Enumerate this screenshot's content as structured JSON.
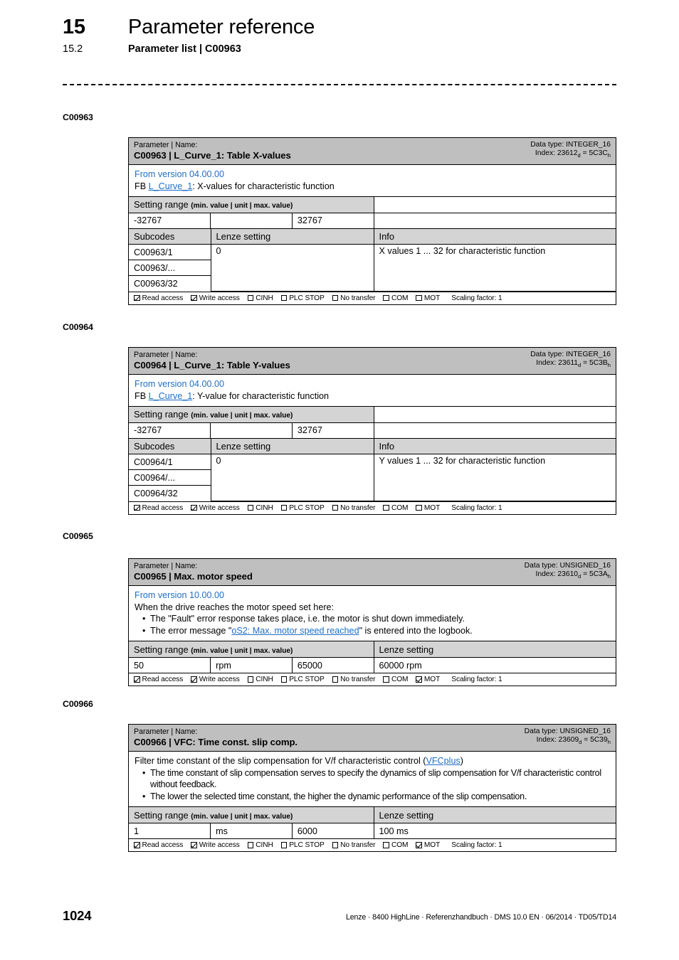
{
  "header": {
    "chapter_number": "15",
    "chapter_title": "Parameter reference",
    "section_number": "15.2",
    "section_title": "Parameter list | C00963"
  },
  "access_labels": {
    "read": "Read access",
    "write": "Write access",
    "cinh": "CINH",
    "plc_stop": "PLC STOP",
    "no_transfer": "No transfer",
    "com": "COM",
    "mot": "MOT"
  },
  "common": {
    "param_name_label": "Parameter | Name:",
    "setting_range_label": "Setting range",
    "setting_range_hint": "(min. value | unit | max. value)",
    "lenze_setting_label": "Lenze setting",
    "subcodes_label": "Subcodes",
    "info_label": "Info",
    "scaling_factor": "Scaling factor: 1"
  },
  "blocks": [
    {
      "margin_tag": "C00963",
      "title": "C00963 | L_Curve_1: Table X-values",
      "data_type": "Data type: INTEGER_16",
      "index_prefix": "Index: 23612",
      "index_sub1": "d",
      "index_mid": " = 5C3C",
      "index_sub2": "h",
      "from_version": "From version 04.00.00",
      "desc_prefix": "FB ",
      "desc_link": "L_Curve_1",
      "desc_suffix": ": X-values for characteristic function",
      "range_min": "-32767",
      "range_unit": "",
      "range_max": "32767",
      "subcodes": [
        "C00963/1",
        "C00963/...",
        "C00963/32"
      ],
      "subcode_lenze_setting": "0",
      "subcode_info": "X values 1 ... 32 for characteristic function",
      "access": {
        "read": true,
        "write": true,
        "cinh": false,
        "plc_stop": false,
        "no_transfer": false,
        "com": false,
        "mot": false
      }
    },
    {
      "margin_tag": "C00964",
      "title": "C00964 | L_Curve_1: Table Y-values",
      "data_type": "Data type: INTEGER_16",
      "index_prefix": "Index: 23611",
      "index_sub1": "d",
      "index_mid": " = 5C3B",
      "index_sub2": "h",
      "from_version": "From version 04.00.00",
      "desc_prefix": "FB ",
      "desc_link": "L_Curve_1",
      "desc_suffix": ": Y-value for characteristic function",
      "range_min": "-32767",
      "range_unit": "",
      "range_max": "32767",
      "subcodes": [
        "C00964/1",
        "C00964/...",
        "C00964/32"
      ],
      "subcode_lenze_setting": "0",
      "subcode_info": "Y values 1 ... 32 for characteristic function",
      "access": {
        "read": true,
        "write": true,
        "cinh": false,
        "plc_stop": false,
        "no_transfer": false,
        "com": false,
        "mot": false
      }
    },
    {
      "margin_tag": "C00965",
      "title": "C00965 | Max. motor speed",
      "data_type": "Data type: UNSIGNED_16",
      "index_prefix": "Index: 23610",
      "index_sub1": "d",
      "index_mid": " = 5C3A",
      "index_sub2": "h",
      "from_version": "From version 10.00.00",
      "intro": "When the drive reaches the motor speed set here:",
      "bullets": [
        {
          "text": "The \"Fault\" error response takes place, i.e. the motor is shut down immediately."
        },
        {
          "pre": "The error message \"",
          "link": "oS2: Max. motor speed reached",
          "post": "\" is entered into the logbook."
        }
      ],
      "range_min": "50",
      "range_unit": "rpm",
      "range_max": "65000",
      "lenze_value": "60000 rpm",
      "access": {
        "read": true,
        "write": true,
        "cinh": false,
        "plc_stop": false,
        "no_transfer": false,
        "com": false,
        "mot": true
      }
    },
    {
      "margin_tag": "C00966",
      "title": "C00966 | VFC: Time const. slip comp.",
      "data_type": "Data type: UNSIGNED_16",
      "index_prefix": "Index: 23609",
      "index_sub1": "d",
      "index_mid": " = 5C39",
      "index_sub2": "h",
      "intro_pre": "Filter time constant of the slip compensation for V/f characteristic control (",
      "intro_link": "VFCplus",
      "intro_post": ")",
      "bullets": [
        {
          "text": "The time constant of slip compensation serves to specify the dynamics of slip compensation for V/f characteristic control without feedback."
        },
        {
          "text": "The lower the selected time constant, the higher the dynamic performance of the slip compensation."
        }
      ],
      "range_min": "1",
      "range_unit": "ms",
      "range_max": "6000",
      "lenze_value": "100 ms",
      "access": {
        "read": true,
        "write": true,
        "cinh": false,
        "plc_stop": false,
        "no_transfer": false,
        "com": false,
        "mot": true
      }
    }
  ],
  "footer": {
    "page_number": "1024",
    "imprint": "Lenze · 8400 HighLine · Referenzhandbuch · DMS 10.0 EN · 06/2014 · TD05/TD14"
  }
}
